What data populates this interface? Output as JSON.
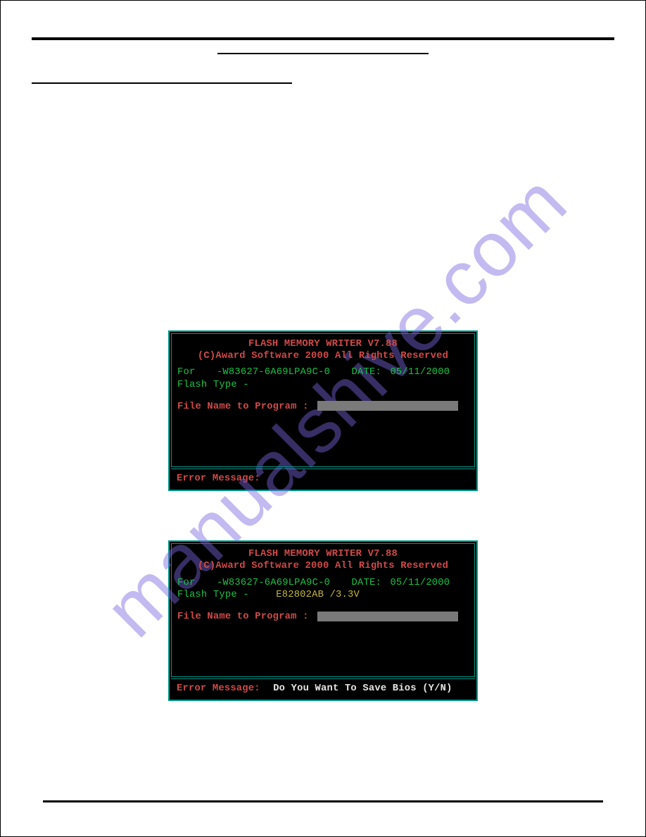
{
  "watermark": "manualshive.com",
  "screens": [
    {
      "title": "FLASH  MEMORY  WRITER V7.88",
      "copyright": "(C)Award Software 2000 All Rights Reserved",
      "for_label": "For",
      "for_value": "-W83627-6A69LPA9C-0",
      "date_label": "DATE:",
      "date_value": "05/11/2000",
      "flash_type_label": "Flash Type -",
      "flash_type_value": "",
      "program_label": "File Name to Program :",
      "error_label": "Error Message:",
      "error_value": ""
    },
    {
      "title": "FLASH  MEMORY  WRITER V7.88",
      "copyright": "(C)Award Software 2000 All Rights Reserved",
      "for_label": "For",
      "for_value": "-W83627-6A69LPA9C-0",
      "date_label": "DATE:",
      "date_value": "05/11/2000",
      "flash_type_label": "Flash Type -",
      "flash_type_value": "E82802AB /3.3V",
      "program_label": "File Name to Program :",
      "error_label": "Error Message:",
      "error_value": "Do You Want To Save Bios (Y/N)"
    }
  ]
}
